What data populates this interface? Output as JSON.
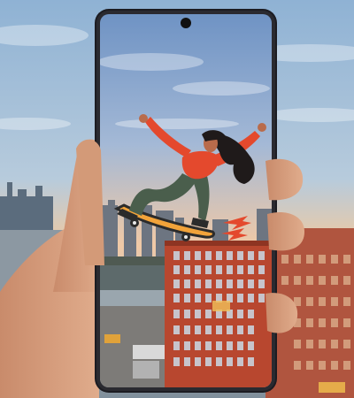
{
  "image": {
    "description_icons": [
      "phone-icon",
      "skateboarder-illustration",
      "hand-icon",
      "building-icon"
    ],
    "colors": {
      "sky_top": "#8fb2d4",
      "sky_horizon": "#e8c9a8",
      "phone_frame": "#1c1c22",
      "building_brick": "#b8472f",
      "skater_top": "#e4492d",
      "skater_pants": "#4a5e4c",
      "skin": "#d7a07e",
      "skateboard": "#f2a33a"
    }
  }
}
